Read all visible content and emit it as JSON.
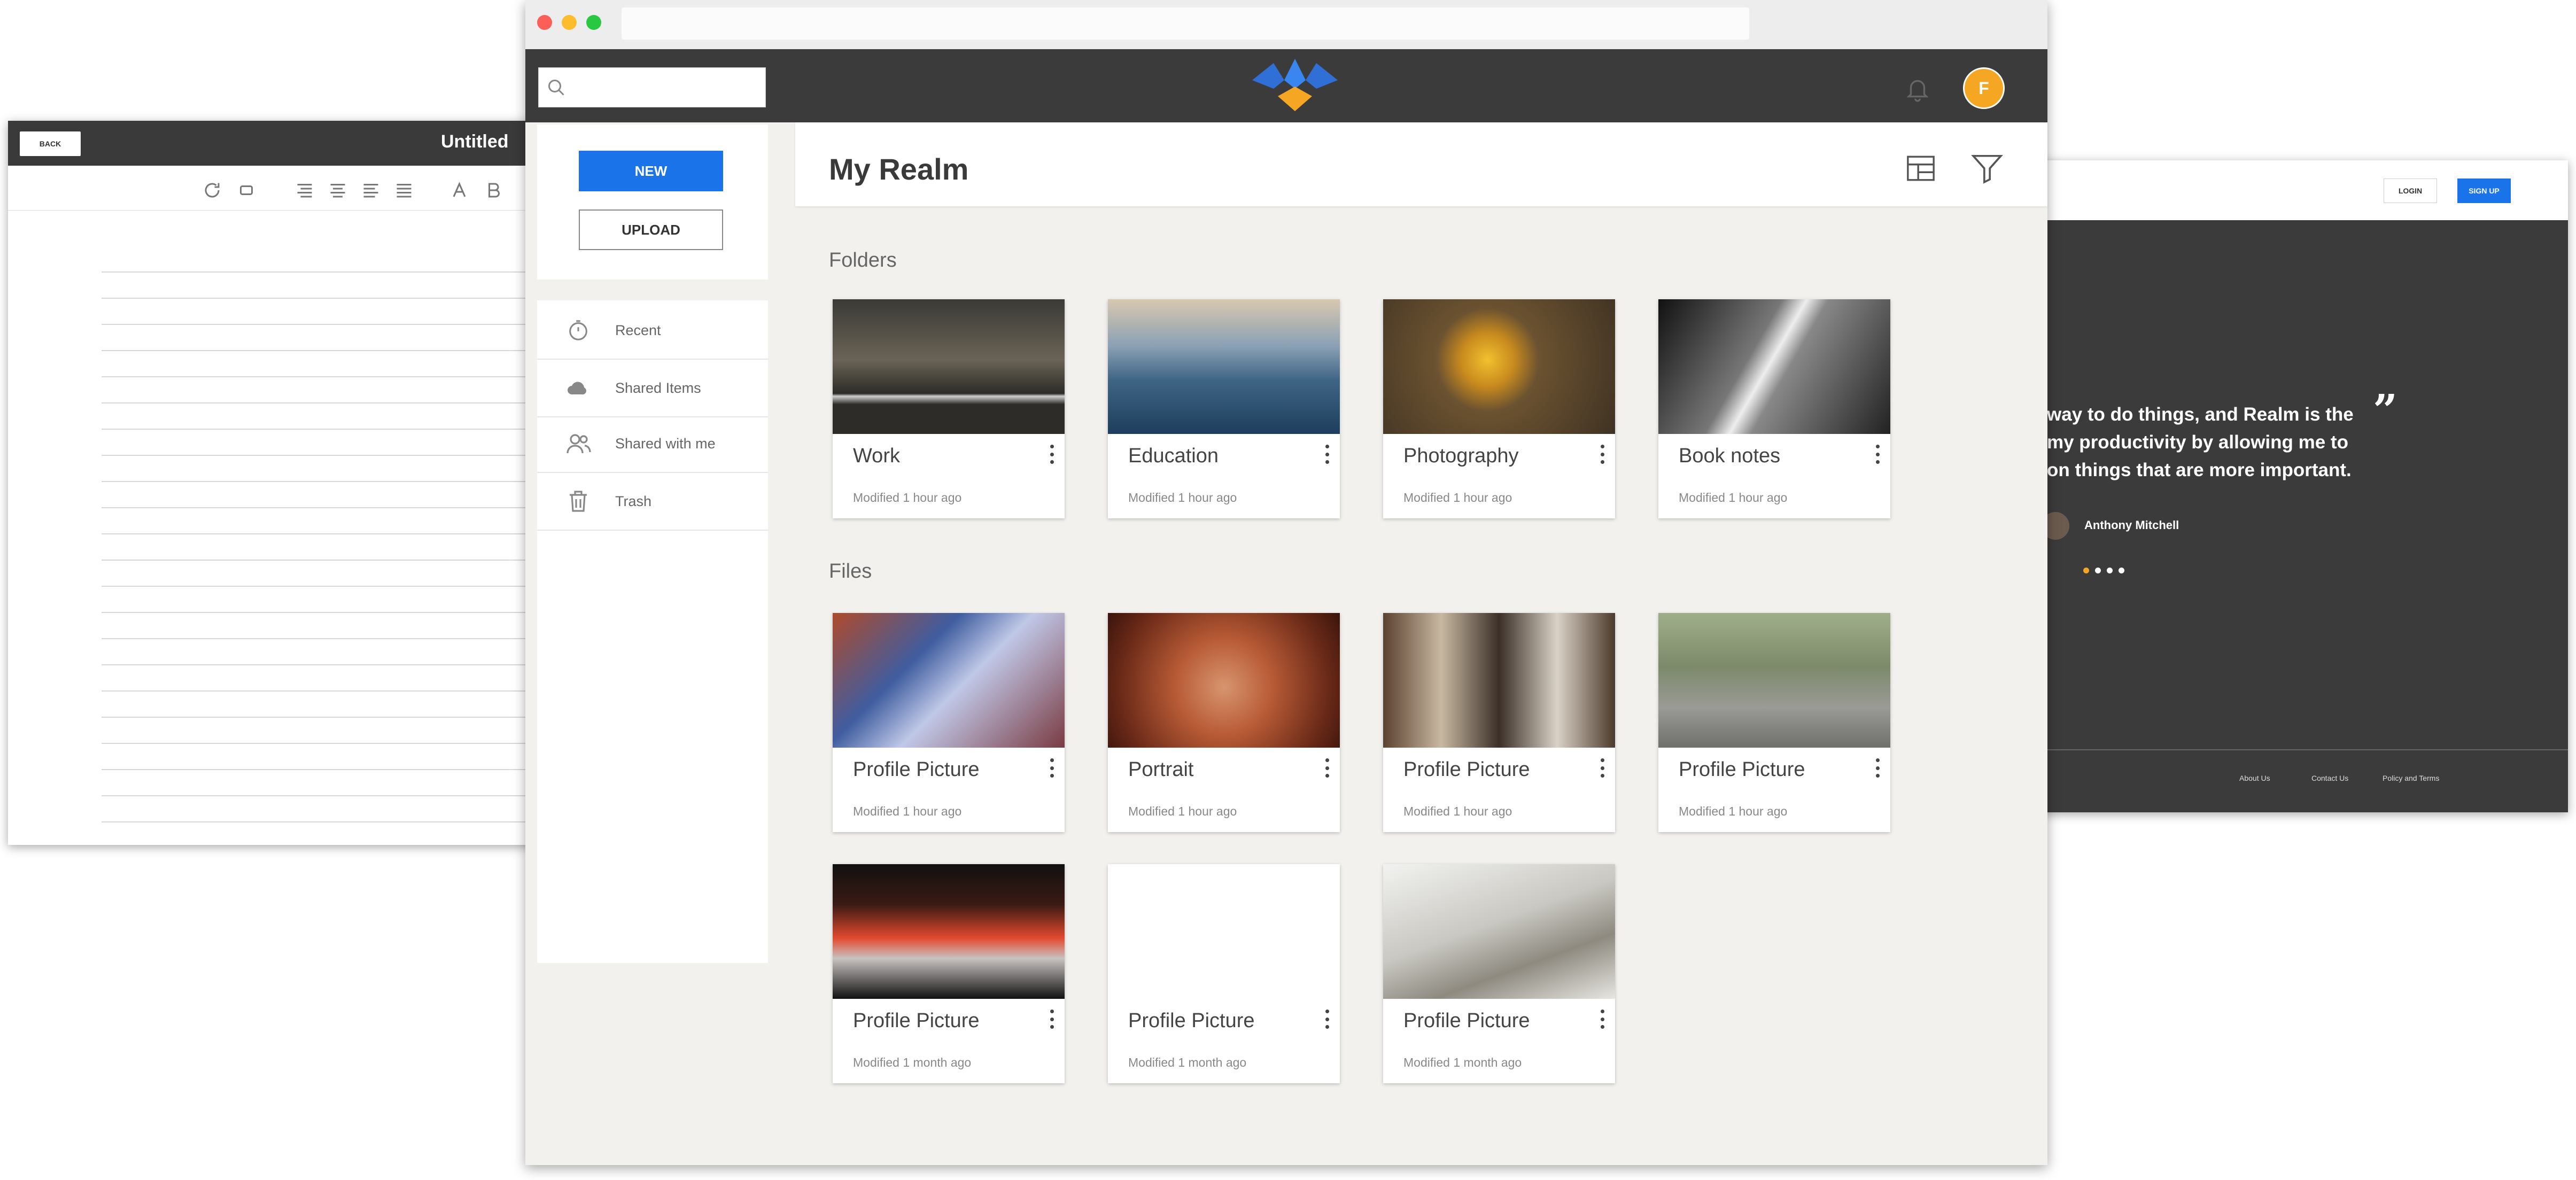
{
  "editor": {
    "back_label": "BACK",
    "title": "Untitled",
    "tool_icons": [
      "refresh-icon",
      "repeat-icon",
      "align-right-icon",
      "align-center-icon",
      "align-left-icon",
      "align-justify-icon",
      "font-style-icon",
      "bold-icon"
    ]
  },
  "landing": {
    "login_label": "LOGIN",
    "signup_label": "SIGN UP",
    "quote_lines": [
      "way to do things, and Realm is the",
      "my productivity by allowing me to",
      "on things that are more important."
    ],
    "quote_mark": "”",
    "author": "Anthony Mitchell",
    "footer_links": [
      "About Us",
      "Contact Us",
      "Policy and Terms"
    ],
    "colors": {
      "accent": "#1a73e8",
      "dot_active": "#f5a623"
    }
  },
  "app": {
    "user_initial": "F",
    "new_label": "NEW",
    "upload_label": "UPLOAD",
    "nav": [
      {
        "label": "Recent",
        "icon": "stopwatch-icon"
      },
      {
        "label": "Shared Items",
        "icon": "cloud-icon"
      },
      {
        "label": "Shared with me",
        "icon": "users-icon"
      },
      {
        "label": "Trash",
        "icon": "trash-icon"
      }
    ],
    "page_title": "My Realm",
    "folders_heading": "Folders",
    "files_heading": "Files",
    "folders": [
      {
        "title": "Work",
        "modified": "Modified 1 hour ago"
      },
      {
        "title": "Education",
        "modified": "Modified 1 hour ago"
      },
      {
        "title": "Photography",
        "modified": "Modified 1 hour ago"
      },
      {
        "title": "Book notes",
        "modified": "Modified 1 hour ago"
      }
    ],
    "files": [
      {
        "title": "Profile Picture",
        "modified": "Modified 1 hour ago"
      },
      {
        "title": "Portrait",
        "modified": "Modified 1 hour ago"
      },
      {
        "title": "Profile Picture",
        "modified": "Modified 1 hour ago"
      },
      {
        "title": "Profile Picture",
        "modified": "Modified 1 hour ago"
      },
      {
        "title": "Profile Picture",
        "modified": "Modified 1 month ago"
      },
      {
        "title": "Profile Picture",
        "modified": "Modified 1 month ago"
      },
      {
        "title": "Profile Picture",
        "modified": "Modified 1 month ago"
      }
    ],
    "colors": {
      "topbar": "#3b3b3b",
      "accent": "#1a73e8",
      "avatar": "#f5a623"
    }
  }
}
